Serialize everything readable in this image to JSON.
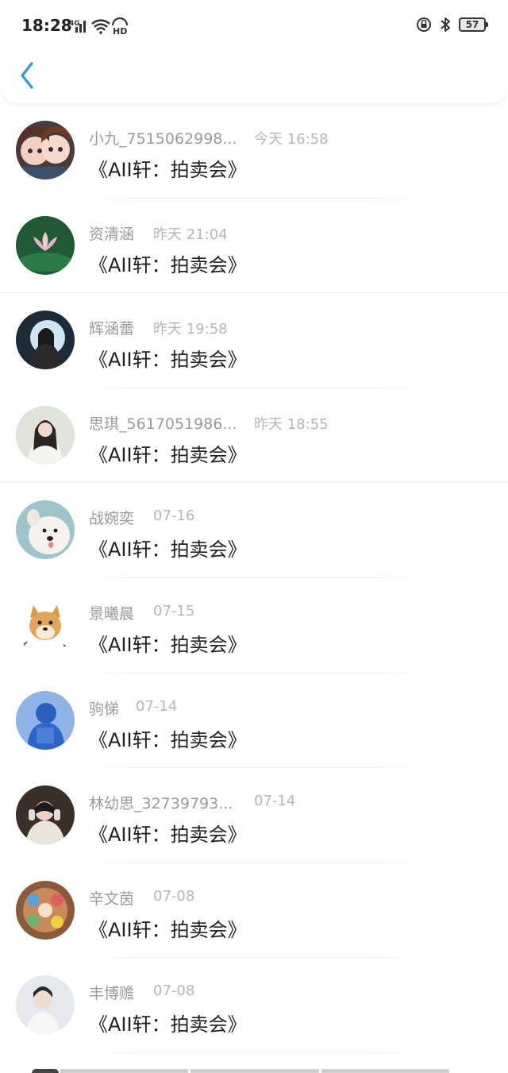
{
  "status_bar": {
    "time": "18:28",
    "network": "4G",
    "hd": "HD",
    "battery": "57"
  },
  "messages": [
    {
      "name": "小九_7515062998...",
      "time": "今天 16:58",
      "text": "《AII轩：拍卖会》",
      "avatar": "girls-cartoon"
    },
    {
      "name": "资清涵",
      "time": "昨天 21:04",
      "text": "《AII轩：拍卖会》",
      "avatar": "lotus"
    },
    {
      "name": "辉涵蕾",
      "time": "昨天 19:58",
      "text": "《AII轩：拍卖会》",
      "avatar": "girl-moon"
    },
    {
      "name": "思琪_5617051986...",
      "time": "昨天 18:55",
      "text": "《AII轩：拍卖会》",
      "avatar": "girl-white"
    },
    {
      "name": "战婉奕",
      "time": "07-16",
      "text": "《AII轩：拍卖会》",
      "avatar": "white-dog"
    },
    {
      "name": "景曦晨",
      "time": "07-15",
      "text": "《AII轩：拍卖会》",
      "avatar": "shiba-doge"
    },
    {
      "name": "驹悌",
      "time": "07-14",
      "text": "《AII轩：拍卖会》",
      "avatar": "blue-figure"
    },
    {
      "name": "林幼思_32739793...",
      "time": "07-14",
      "text": "《AII轩：拍卖会》",
      "avatar": "girl-headphones"
    },
    {
      "name": "辛文茵",
      "time": "07-08",
      "text": "《AII轩：拍卖会》",
      "avatar": "cartoon-collage"
    },
    {
      "name": "丰博赡",
      "time": "07-08",
      "text": "《AII轩：拍卖会》",
      "avatar": "boy-light"
    }
  ],
  "colors": {
    "accent": "#2f9bdf",
    "name": "#9a9a9a",
    "time": "#b6b6b6",
    "message": "#222222"
  }
}
